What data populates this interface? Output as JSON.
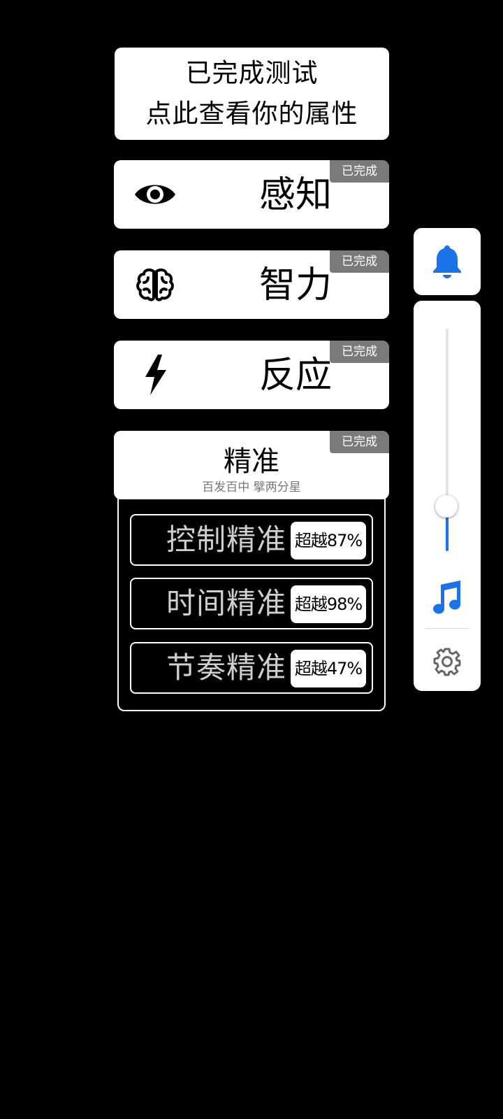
{
  "summary": {
    "line1": "已完成测试",
    "line2": "点此查看你的属性"
  },
  "categories": [
    {
      "title": "感知",
      "icon": "eye-icon",
      "badge": "已完成"
    },
    {
      "title": "智力",
      "icon": "brain-icon",
      "badge": "已完成"
    },
    {
      "title": "反应",
      "icon": "lightning-icon",
      "badge": "已完成"
    }
  ],
  "precision": {
    "title": "精准",
    "subtitle": "百发百中 擘两分星",
    "badge": "已完成",
    "items": [
      {
        "label": "控制精准",
        "result": "超越87%"
      },
      {
        "label": "时间精准",
        "result": "超越98%"
      },
      {
        "label": "节奏精准",
        "result": "超越47%"
      }
    ]
  },
  "side": {
    "volume_level": 0.2,
    "accent_color": "#1a73e8",
    "icons": [
      "bell-icon",
      "music-note-icon",
      "gear-icon"
    ]
  }
}
